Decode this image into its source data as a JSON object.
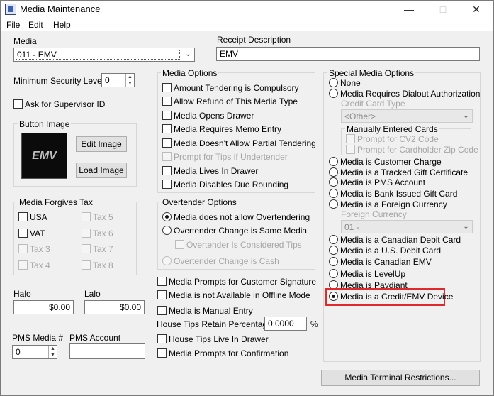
{
  "window": {
    "title": "Media Maintenance"
  },
  "menu": [
    "File",
    "Edit",
    "Help"
  ],
  "media": {
    "label": "Media",
    "value": "011 - EMV"
  },
  "receipt": {
    "label": "Receipt Description",
    "value": "EMV"
  },
  "min_security": {
    "label": "Minimum Security Level:",
    "value": "0"
  },
  "ask_supervisor": {
    "label": "Ask for Supervisor ID",
    "checked": false
  },
  "button_image": {
    "title": "Button Image",
    "preview": "EMV",
    "edit": "Edit Image",
    "load": "Load Image"
  },
  "forgives_tax": {
    "title": "Media Forgives Tax",
    "items": [
      {
        "label": "USA",
        "checked": false,
        "enabled": true
      },
      {
        "label": "Tax 5",
        "checked": false,
        "enabled": false
      },
      {
        "label": "VAT",
        "checked": false,
        "enabled": true
      },
      {
        "label": "Tax 6",
        "checked": false,
        "enabled": false
      },
      {
        "label": "Tax 3",
        "checked": false,
        "enabled": false
      },
      {
        "label": "Tax 7",
        "checked": false,
        "enabled": false
      },
      {
        "label": "Tax 4",
        "checked": false,
        "enabled": false
      },
      {
        "label": "Tax 8",
        "checked": false,
        "enabled": false
      }
    ]
  },
  "halo": {
    "label": "Halo",
    "value": "$0.00"
  },
  "lalo": {
    "label": "Lalo",
    "value": "$0.00"
  },
  "pms_media": {
    "label": "PMS Media #",
    "value": "0"
  },
  "pms_account": {
    "label": "PMS Account",
    "value": ""
  },
  "media_options": {
    "title": "Media Options",
    "items": [
      {
        "label": "Amount Tendering is Compulsory",
        "checked": false,
        "enabled": true
      },
      {
        "label": "Allow Refund of This Media Type",
        "checked": false,
        "enabled": true
      },
      {
        "label": "Media Opens Drawer",
        "checked": false,
        "enabled": true
      },
      {
        "label": "Media Requires Memo Entry",
        "checked": false,
        "enabled": true
      },
      {
        "label": "Media Doesn't Allow Partial Tendering",
        "checked": false,
        "enabled": true
      },
      {
        "label": "Prompt for Tips if Undertender",
        "checked": false,
        "enabled": false
      },
      {
        "label": "Media Lives In Drawer",
        "checked": false,
        "enabled": true
      },
      {
        "label": "Media Disables Due Rounding",
        "checked": false,
        "enabled": true
      }
    ]
  },
  "overtender": {
    "title": "Overtender Options",
    "opt1": "Media does not allow Overtendering",
    "opt2": "Overtender Change is Same Media",
    "sub": "Overtender Is Considered Tips",
    "opt3": "Overtender Change is Cash",
    "selected": 1
  },
  "lower_options": [
    {
      "label": "Media Prompts for Customer Signature",
      "checked": false
    },
    {
      "label": "Media is not Available in Offline Mode",
      "checked": false
    },
    {
      "label": "Media is Manual Entry",
      "checked": false
    }
  ],
  "house_tips": {
    "label": "House Tips Retain Percentage:",
    "value": "0.0000",
    "unit": "%"
  },
  "lower_options2": [
    {
      "label": "House Tips Live In Drawer",
      "checked": false
    },
    {
      "label": "Media Prompts for Confirmation",
      "checked": false
    }
  ],
  "special": {
    "title": "Special Media Options",
    "none": "None",
    "dialout": "Media Requires Dialout Authorization",
    "cc_type_label": "Credit Card Type",
    "cc_type_value": "<Other>",
    "manual_cards_title": "Manually Entered Cards",
    "prompt_cv2": "Prompt for CV2 Code",
    "prompt_zip": "Prompt for Cardholder Zip Code",
    "customer_charge": "Media is Customer Charge",
    "gift_cert": "Media is a Tracked Gift Certificate",
    "pms_account": "Media is PMS Account",
    "bank_gift": "Media is Bank Issued Gift Card",
    "foreign": "Media is a Foreign Currency",
    "foreign_label": "Foreign Currency",
    "foreign_value": "01 -",
    "canadian_debit": "Media is a Canadian Debit Card",
    "us_debit": "Media is a U.S. Debit Card",
    "canadian_emv": "Media is Canadian EMV",
    "levelup": "Media is LevelUp",
    "paydiant": "Media is Paydiant",
    "credit_emv": "Media is a Credit/EMV Device",
    "selected": "credit_emv"
  },
  "terminal_btn": "Media Terminal Restrictions...",
  "colors": {
    "highlight": "#e0292a",
    "disabled": "#a6a6a6"
  }
}
